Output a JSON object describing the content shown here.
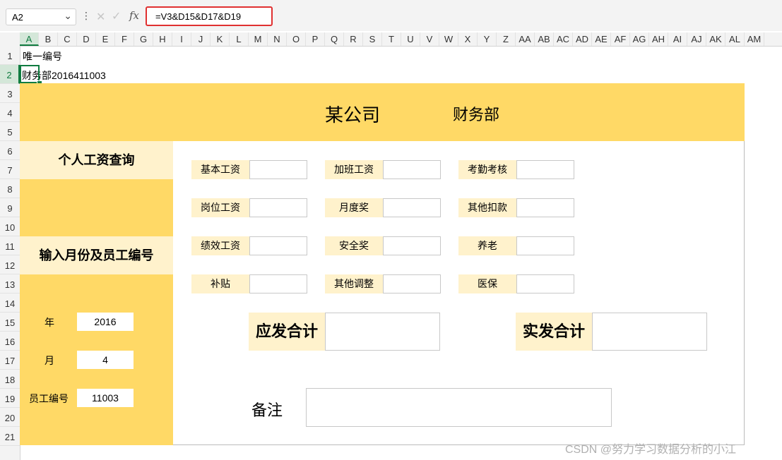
{
  "formula_bar": {
    "name_box": "A2",
    "name_box_chevron": "⌄",
    "more": "⋮",
    "cancel_glyph": "✕",
    "enter_glyph": "✓",
    "fx": "fx",
    "formula": "=V3&D15&D17&D19"
  },
  "columns": [
    "A",
    "B",
    "C",
    "D",
    "E",
    "F",
    "G",
    "H",
    "I",
    "J",
    "K",
    "L",
    "M",
    "N",
    "O",
    "P",
    "Q",
    "R",
    "S",
    "T",
    "U",
    "V",
    "W",
    "X",
    "Y",
    "Z",
    "AA",
    "AB",
    "AC",
    "AD",
    "AE",
    "AF",
    "AG",
    "AH",
    "AI",
    "AJ",
    "AK",
    "AL",
    "AM"
  ],
  "rows": [
    "1",
    "2",
    "3",
    "4",
    "5",
    "6",
    "7",
    "8",
    "9",
    "10",
    "11",
    "12",
    "13",
    "14",
    "15",
    "16",
    "17",
    "18",
    "19",
    "20",
    "21"
  ],
  "selected_cell": {
    "column": "A",
    "row": "2"
  },
  "cells": {
    "a1": "唯一编号",
    "a2": "财务部2016411003"
  },
  "dashboard": {
    "company": "某公司",
    "department": "财务部",
    "query_title": "个人工资查询",
    "input_title": "输入月份及员工编号",
    "year_label": "年",
    "year_value": "2016",
    "month_label": "月",
    "month_value": "4",
    "emp_label": "员工编号",
    "emp_value": "11003",
    "salary_items": [
      {
        "label": "基本工资"
      },
      {
        "label": "加班工资"
      },
      {
        "label": "考勤考核"
      },
      {
        "label": "岗位工资"
      },
      {
        "label": "月度奖"
      },
      {
        "label": "其他扣款"
      },
      {
        "label": "绩效工资"
      },
      {
        "label": "安全奖"
      },
      {
        "label": "养老"
      },
      {
        "label": "补贴"
      },
      {
        "label": "其他调整"
      },
      {
        "label": "医保"
      }
    ],
    "gross_label": "应发合计",
    "net_label": "实发合计",
    "remark_label": "备注"
  },
  "watermark": "CSDN @努力学习数据分析的小江",
  "colors": {
    "accent_yellow": "#ffd966",
    "light_yellow": "#fff2cc",
    "selection_green": "#107c41",
    "formula_highlight": "#e03030"
  }
}
